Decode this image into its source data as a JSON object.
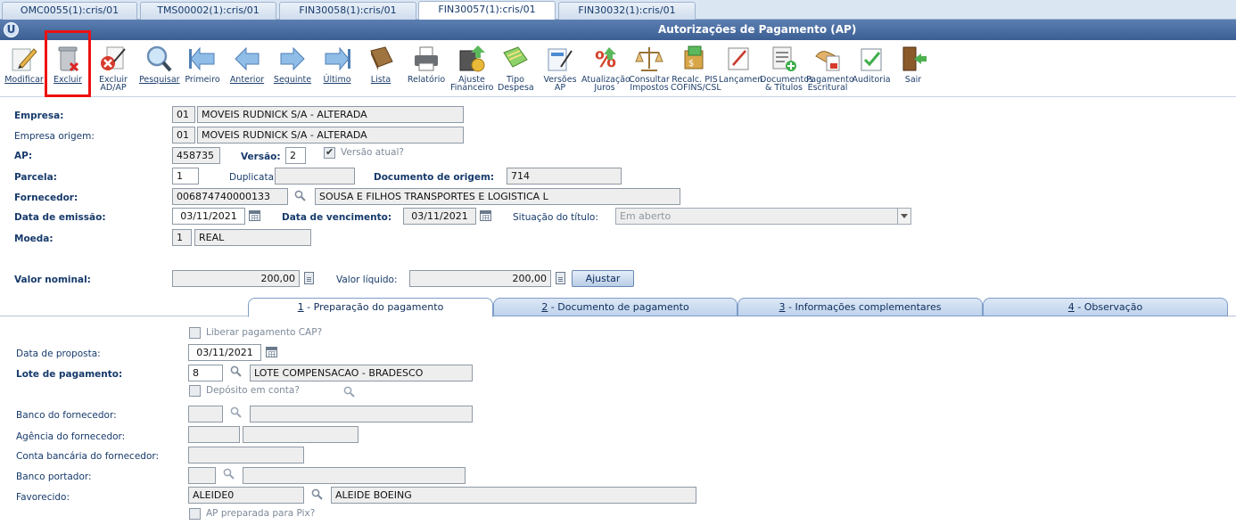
{
  "window_tabs": [
    "OMC0055(1):cris/01",
    "TMS00002(1):cris/01",
    "FIN30058(1):cris/01",
    "FIN30057(1):cris/01",
    "FIN30032(1):cris/01"
  ],
  "title": "Autorizações de Pagamento (AP)",
  "toolbar": [
    {
      "label": "Modificar",
      "icon": "edit-icon"
    },
    {
      "label": "Excluir",
      "icon": "trash-icon"
    },
    {
      "label": "Excluir\nAD/AP",
      "icon": "delete-doc-icon"
    },
    {
      "label": "Pesquisar",
      "icon": "search-icon"
    },
    {
      "label": "Primeiro",
      "icon": "first-icon"
    },
    {
      "label": "Anterior",
      "icon": "previous-icon"
    },
    {
      "label": "Seguinte",
      "icon": "next-icon"
    },
    {
      "label": "Último",
      "icon": "last-icon"
    },
    {
      "label": "Lista",
      "icon": "book-icon"
    },
    {
      "label": "Relatório",
      "icon": "printer-icon"
    },
    {
      "label": "Ajuste\nFinanceiro",
      "icon": "finance-adjust-icon"
    },
    {
      "label": "Tipo\nDespesa",
      "icon": "expense-type-icon"
    },
    {
      "label": "Versões\nAP",
      "icon": "versions-icon"
    },
    {
      "label": "Atualização\nJuros",
      "icon": "interest-icon"
    },
    {
      "label": "Consultar\nImpostos",
      "icon": "scales-icon"
    },
    {
      "label": "Recalc. PIS\nCOFINS/CSL",
      "icon": "recalc-icon"
    },
    {
      "label": "Lançamen.",
      "icon": "entries-icon"
    },
    {
      "label": "Documentos\n& Títulos",
      "icon": "documents-icon"
    },
    {
      "label": "Pagamento\nEscritural",
      "icon": "payment-icon"
    },
    {
      "label": "Auditoria",
      "icon": "audit-icon"
    },
    {
      "label": "Sair",
      "icon": "exit-icon"
    }
  ],
  "form": {
    "empresa_label": "Empresa:",
    "empresa_code": "01",
    "empresa_name": "MOVEIS RUDNICK S/A - ALTERADA",
    "empresa_origem_label": "Empresa origem:",
    "empresa_origem_code": "01",
    "empresa_origem_name": "MOVEIS RUDNICK S/A - ALTERADA",
    "ap_label": "AP:",
    "ap_value": "458735",
    "versao_label": "Versão:",
    "versao_value": "2",
    "versao_atual_label": "Versão atual?",
    "parcela_label": "Parcela:",
    "parcela_value": "1",
    "duplicata_label": "Duplicata:",
    "duplicata_value": "",
    "doc_origem_label": "Documento de origem:",
    "doc_origem_value": "714",
    "fornecedor_label": "Fornecedor:",
    "fornecedor_code": "006874740000133",
    "fornecedor_name": "SOUSA E FILHOS TRANSPORTES E LOGISTICA L",
    "data_emissao_label": "Data de emissão:",
    "data_emissao_value": "03/11/2021",
    "data_vencimento_label": "Data de vencimento:",
    "data_vencimento_value": "03/11/2021",
    "situacao_label": "Situação do título:",
    "situacao_value": "Em aberto",
    "moeda_label": "Moeda:",
    "moeda_code": "1",
    "moeda_name": "REAL",
    "valor_nominal_label": "Valor nominal:",
    "valor_nominal_value": "200,00",
    "valor_liquido_label": "Valor líquido:",
    "valor_liquido_value": "200,00",
    "ajustar_label": "Ajustar"
  },
  "section_tabs": [
    {
      "num": "1",
      "label": " - Preparação do pagamento"
    },
    {
      "num": "2",
      "label": " - Documento de pagamento"
    },
    {
      "num": "3",
      "label": " - Informações complementares"
    },
    {
      "num": "4",
      "label": " - Observação"
    }
  ],
  "prep": {
    "liberar_label": "Liberar pagamento CAP?",
    "data_proposta_label": "Data de proposta:",
    "data_proposta_value": "03/11/2021",
    "lote_label": "Lote de pagamento:",
    "lote_code": "8",
    "lote_name": "LOTE COMPENSACAO - BRADESCO",
    "deposito_label": "Depósito em conta?",
    "banco_fornecedor_label": "Banco do fornecedor:",
    "agencia_label": "Agência do fornecedor:",
    "conta_label": "Conta bancária do fornecedor:",
    "banco_portador_label": "Banco portador:",
    "favorecido_label": "Favorecido:",
    "favorecido_code": "ALEIDE0",
    "favorecido_name": "ALEIDE BOEING",
    "pix_label": "AP preparada para Pix?"
  }
}
